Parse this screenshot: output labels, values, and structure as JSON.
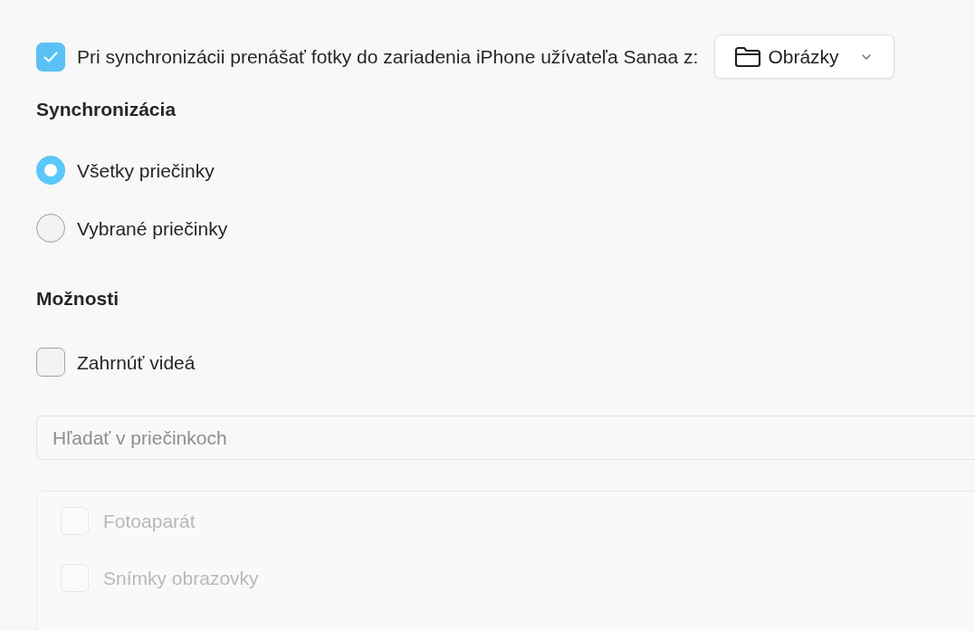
{
  "sync_photos": {
    "checked": true,
    "label": "Pri synchronizácii prenášať fotky do zariadenia iPhone užívateľa Sanaa z:",
    "source": {
      "value": "Obrázky"
    }
  },
  "sync_section": {
    "heading": "Synchronizácia",
    "options": [
      {
        "label": "Všetky priečinky",
        "selected": true
      },
      {
        "label": "Vybrané priečinky",
        "selected": false
      }
    ]
  },
  "options_section": {
    "heading": "Možnosti",
    "include_videos": {
      "label": "Zahrnúť videá",
      "checked": false
    }
  },
  "folder_search": {
    "placeholder": "Hľadať v priečinkoch"
  },
  "folder_list": {
    "disabled": true,
    "items": [
      {
        "label": "Fotoaparát",
        "checked": false
      },
      {
        "label": "Snímky obrazovky",
        "checked": false
      }
    ]
  }
}
